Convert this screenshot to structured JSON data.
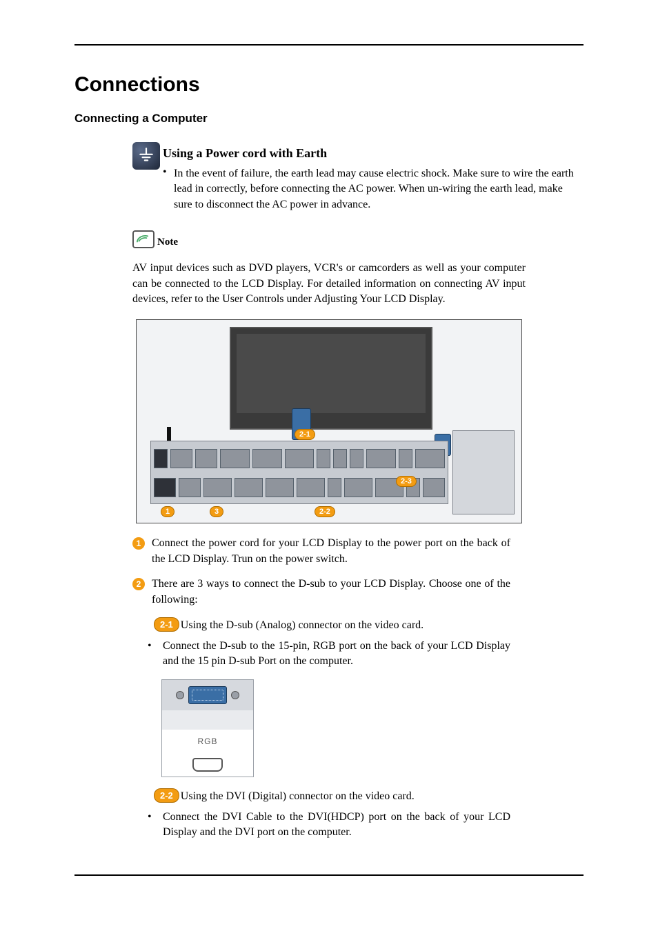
{
  "title": "Connections",
  "subtitle": "Connecting a Computer",
  "earth": {
    "heading": "Using a Power cord with Earth",
    "body": "In the event of failure, the earth lead may cause electric shock. Make sure to wire the earth lead in correctly, before connecting the AC power. When un-wiring the earth lead, make sure to disconnect the AC power in advance."
  },
  "note": {
    "label": "Note",
    "body": "AV input devices such as DVD players, VCR's or camcorders as well as your computer can be connected to the LCD Display. For detailed information on connecting AV input devices, refer to the User Controls under Adjusting Your LCD Display."
  },
  "diagram_badges": {
    "b1": "1",
    "b21": "2-1",
    "b22": "2-2",
    "b23": "2-3",
    "b3": "3"
  },
  "steps": [
    {
      "num": "1",
      "text": "Connect the power cord for your LCD Display to the power port on the back of the LCD Display. Trun on the power switch."
    },
    {
      "num": "2",
      "text": "There are 3 ways to connect the D-sub to your LCD Display. Choose one of the following:"
    }
  ],
  "sub21": {
    "badge": "2-1",
    "text": "Using the D-sub (Analog) connector on the video card."
  },
  "bullet21": "Connect the D-sub to the 15-pin, RGB port on the back of your LCD Display and the 15 pin D-sub Port on the computer.",
  "rgb_label": "RGB",
  "sub22": {
    "badge": "2-2",
    "text": "Using the DVI (Digital) connector on the video card."
  },
  "bullet22": "Connect the DVI Cable to the DVI(HDCP) port on the back of your LCD Display and the DVI port on the computer."
}
